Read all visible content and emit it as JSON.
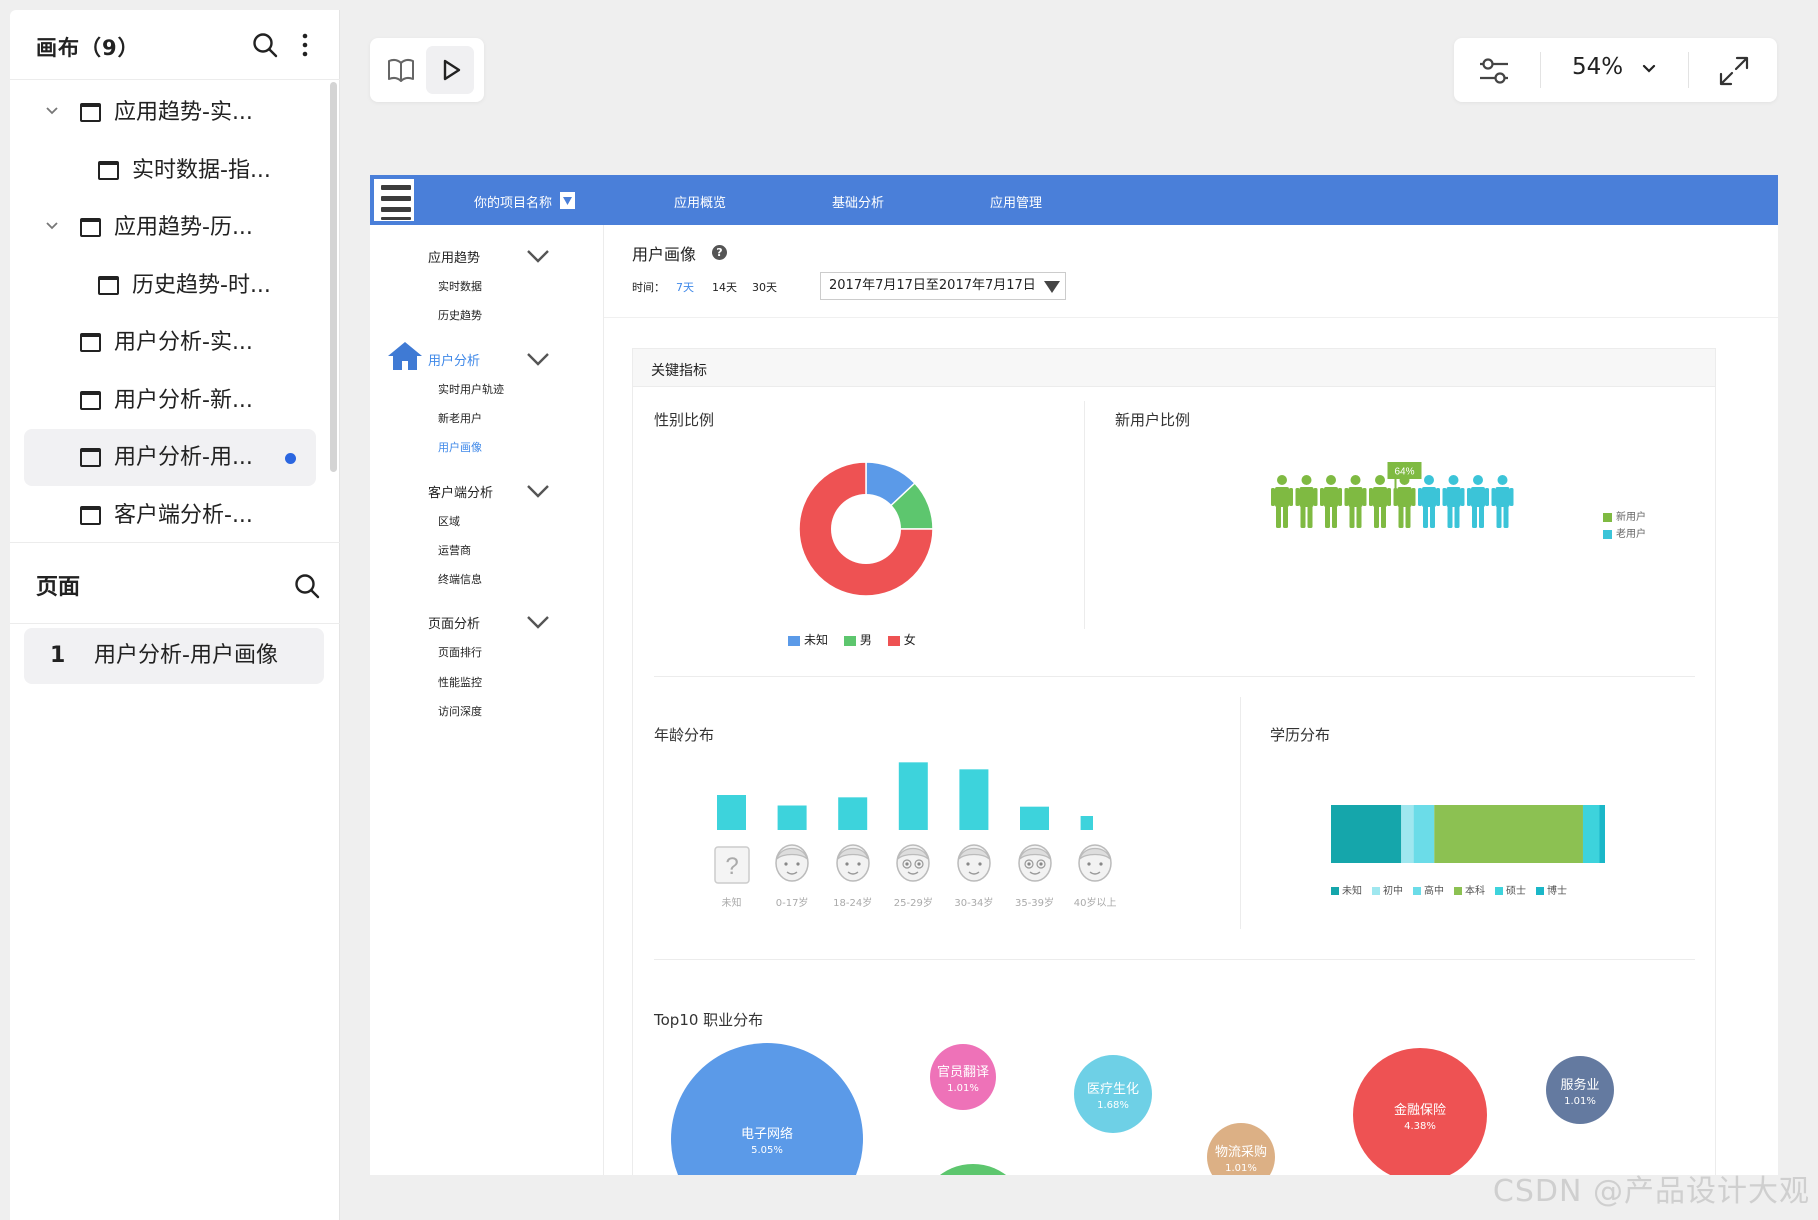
{
  "sidebar": {
    "title": "画布（9）",
    "tree": [
      {
        "label": "应用趋势-实...",
        "level": 0,
        "expandable": true
      },
      {
        "label": "实时数据-指...",
        "level": 1,
        "expandable": false
      },
      {
        "label": "应用趋势-历...",
        "level": 0,
        "expandable": true
      },
      {
        "label": "历史趋势-时...",
        "level": 1,
        "expandable": false
      },
      {
        "label": "用户分析-实...",
        "level": 0,
        "expandable": false
      },
      {
        "label": "用户分析-新...",
        "level": 0,
        "expandable": false
      },
      {
        "label": "用户分析-用...",
        "level": 0,
        "expandable": false,
        "active": true
      },
      {
        "label": "客户端分析-...",
        "level": 0,
        "expandable": false
      }
    ],
    "pages_title": "页面",
    "pages": [
      {
        "num": "1",
        "label": "用户分析-用户画像"
      }
    ]
  },
  "toolbar": {
    "zoom": "54%"
  },
  "proto": {
    "nav": {
      "project": "你的项目名称",
      "items": [
        "应用概览",
        "基础分析",
        "应用管理"
      ]
    },
    "side": {
      "groups": [
        {
          "label": "应用趋势",
          "items": [
            "实时数据",
            "历史趋势"
          ]
        },
        {
          "label": "用户分析",
          "items": [
            "实时用户轨迹",
            "新老用户",
            "用户画像"
          ]
        },
        {
          "label": "客户端分析",
          "items": [
            "区域",
            "运营商",
            "终端信息"
          ]
        },
        {
          "label": "页面分析",
          "items": [
            "页面排行",
            "性能监控",
            "访问深度"
          ]
        }
      ]
    },
    "header": {
      "title": "用户画像",
      "help": "?",
      "time_label": "时间：",
      "ranges": [
        "7天",
        "14天",
        "30天"
      ],
      "date_range": "2017年7月17日至2017年7月17日"
    },
    "panel": {
      "title": "关键指标",
      "gender": {
        "title": "性别比例",
        "legend": [
          "未知",
          "男",
          "女"
        ]
      },
      "newuser": {
        "title": "新用户比例",
        "badge": "64%",
        "legend": [
          "新用户",
          "老用户"
        ]
      },
      "age": {
        "title": "年龄分布",
        "labels": [
          "未知",
          "0-17岁",
          "18-24岁",
          "25-29岁",
          "30-34岁",
          "35-39岁",
          "40岁以上"
        ]
      },
      "edu": {
        "title": "学历分布",
        "legend": [
          "未知",
          "初中",
          "高中",
          "本科",
          "硕士",
          "博士"
        ]
      },
      "job": {
        "title": "Top10 职业分布",
        "bubbles": [
          {
            "name": "电子网络",
            "pct": "5.05%",
            "color": "#5b9ae8"
          },
          {
            "name": "官员翻译",
            "pct": "1.01%",
            "color": "#ee72b8"
          },
          {
            "name": "医疗生化",
            "pct": "1.68%",
            "color": "#6ed0e6"
          },
          {
            "name": "物流采购",
            "pct": "1.01%",
            "color": "#dcb085"
          },
          {
            "name": "金融保险",
            "pct": "4.38%",
            "color": "#ee5253"
          },
          {
            "name": "服务业",
            "pct": "1.01%",
            "color": "#647aa0"
          }
        ]
      }
    }
  },
  "chart_data": [
    {
      "type": "pie",
      "title": "性别比例",
      "categories": [
        "未知",
        "男",
        "女"
      ],
      "values": [
        13,
        12,
        75
      ],
      "colors": [
        "#5b9ae8",
        "#5dc66e",
        "#ee5253"
      ]
    },
    {
      "type": "bar",
      "title": "年龄分布",
      "categories": [
        "未知",
        "0-17岁",
        "18-24岁",
        "25-29岁",
        "30-34岁",
        "35-39岁",
        "40岁以上"
      ],
      "values": [
        30,
        21,
        28,
        58,
        52,
        20,
        12
      ],
      "color": "#3dd3dc"
    },
    {
      "type": "bar",
      "title": "学历分布",
      "stacked": true,
      "categories": [
        "未知",
        "初中",
        "高中",
        "本科",
        "硕士",
        "博士"
      ],
      "values": [
        25.5,
        4.5,
        7.5,
        54,
        6,
        2
      ],
      "colors": [
        "#15a6ab",
        "#9fe7ef",
        "#6bdce8",
        "#8cc152",
        "#3dd3dc",
        "#1ab7c8"
      ]
    },
    {
      "type": "scatter",
      "title": "新用户比例",
      "categories": [
        "新用户",
        "老用户"
      ],
      "values": [
        64,
        36
      ],
      "colors": [
        "#7fba42",
        "#3bc4d8"
      ]
    }
  ]
}
